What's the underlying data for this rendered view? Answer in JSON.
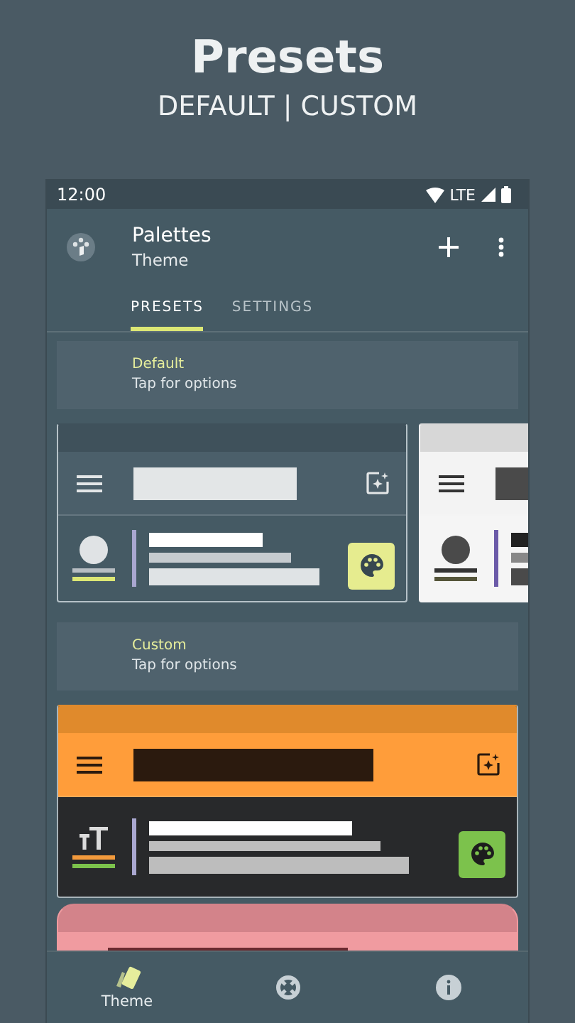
{
  "header": {
    "title": "Presets",
    "subtitle": "DEFAULT | CUSTOM"
  },
  "status_bar": {
    "time": "12:00",
    "network": "LTE"
  },
  "app_bar": {
    "title": "Palettes",
    "subtitle": "Theme"
  },
  "tabs": [
    {
      "label": "PRESETS",
      "selected": true
    },
    {
      "label": "SETTINGS",
      "selected": false
    }
  ],
  "sections": [
    {
      "title": "Default",
      "subtitle": "Tap for options",
      "kind": "row",
      "previews": [
        {
          "kind": "dark"
        },
        {
          "kind": "light"
        }
      ]
    },
    {
      "title": "Custom",
      "subtitle": "Tap for options",
      "kind": "column",
      "previews": [
        {
          "kind": "orange"
        },
        {
          "kind": "pink"
        }
      ]
    }
  ],
  "bottom_nav": [
    {
      "kind": "theme",
      "label": "Theme",
      "selected": true
    },
    {
      "kind": "help",
      "selected": false
    },
    {
      "kind": "info",
      "selected": false
    }
  ]
}
